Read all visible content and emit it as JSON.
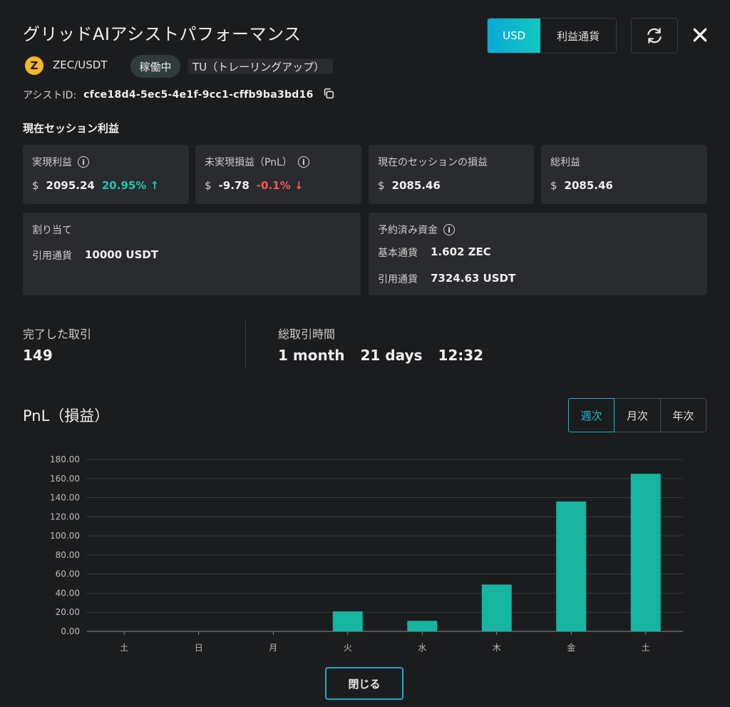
{
  "header": {
    "title": "グリッドAIアシストパフォーマンス",
    "currency_toggle": {
      "options": [
        "USD",
        "利益通貨"
      ],
      "selected": "USD"
    }
  },
  "bot": {
    "pair_icon_letter": "Z",
    "pair": "ZEC/USDT",
    "status": "稼働中",
    "mode": "TU（トレーリングアップ）",
    "assist_id_label": "アシストID:",
    "assist_id": "cfce18d4-5ec5-4e1f-9cc1-cffb9ba3bd16"
  },
  "session": {
    "title": "現在セッション利益",
    "realized": {
      "label": "実現利益",
      "currency": "$",
      "value": "2095.24",
      "pct": "20.95%",
      "arrow": "↑"
    },
    "unrealized": {
      "label": "未実現損益（PnL）",
      "currency": "$",
      "value": "-9.78",
      "pct": "-0.1%",
      "arrow": "↓"
    },
    "session_pnl": {
      "label": "現在のセッションの損益",
      "currency": "$",
      "value": "2085.46"
    },
    "total": {
      "label": "総利益",
      "currency": "$",
      "value": "2085.46"
    },
    "allocation": {
      "label": "割り当て",
      "quote_label": "引用通貨",
      "quote_value": "10000 USDT"
    },
    "reserved": {
      "label": "予約済み資金",
      "base_label": "基本通貨",
      "base_value": "1.602 ZEC",
      "quote_label": "引用通貨",
      "quote_value": "7324.63 USDT"
    }
  },
  "stats": {
    "trades_label": "完了した取引",
    "trades_value": "149",
    "time_label": "総取引時間",
    "time_month": "1 month",
    "time_days": "21 days",
    "time_clock": "12:32"
  },
  "pnl": {
    "title": "PnL（損益）",
    "periods": [
      "週次",
      "月次",
      "年次"
    ],
    "selected_period": "週次"
  },
  "chart_data": {
    "type": "bar",
    "categories": [
      "土",
      "日",
      "月",
      "火",
      "水",
      "木",
      "金",
      "土"
    ],
    "values": [
      0,
      0,
      0,
      21,
      11,
      49,
      136,
      165
    ],
    "ylim": [
      0,
      180
    ],
    "yticks": [
      "0.00",
      "20.00",
      "40.00",
      "60.00",
      "80.00",
      "100.00",
      "120.00",
      "140.00",
      "160.00",
      "180.00"
    ],
    "grid": true,
    "bar_color": "#17b5a0"
  },
  "footer": {
    "close_label": "閉じる"
  }
}
